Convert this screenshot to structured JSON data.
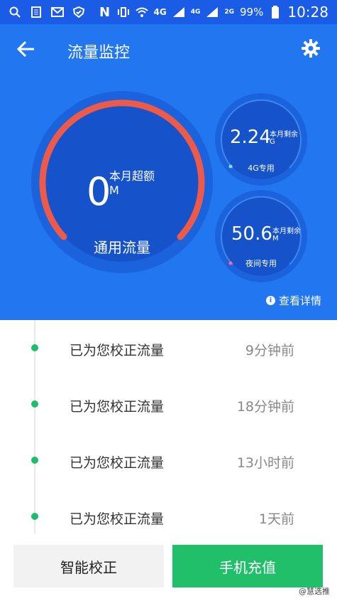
{
  "status_bar": {
    "net_4g": "4G",
    "sig1": "4G",
    "sig2": "2G",
    "battery": "99%",
    "time": "10:28"
  },
  "header": {
    "title": "流量监控"
  },
  "general": {
    "value": "0",
    "label_top": "本月超额",
    "unit": "M",
    "caption": "通用流量"
  },
  "g4": {
    "value": "2.24",
    "label": "本月剩余",
    "unit": "G",
    "caption": "4G专用"
  },
  "night": {
    "value": "50.6",
    "label": "本月剩余",
    "unit": "M",
    "caption": "夜间专用"
  },
  "details_link": "查看详情",
  "history": [
    {
      "text": "已为您校正流量",
      "time": "9分钟前"
    },
    {
      "text": "已为您校正流量",
      "time": "18分钟前"
    },
    {
      "text": "已为您校正流量",
      "time": "13小时前"
    },
    {
      "text": "已为您校正流量",
      "time": "1天前"
    }
  ],
  "buttons": {
    "smart_calibrate": "智能校正",
    "recharge": "手机充值"
  },
  "watermark": "@慧选推"
}
